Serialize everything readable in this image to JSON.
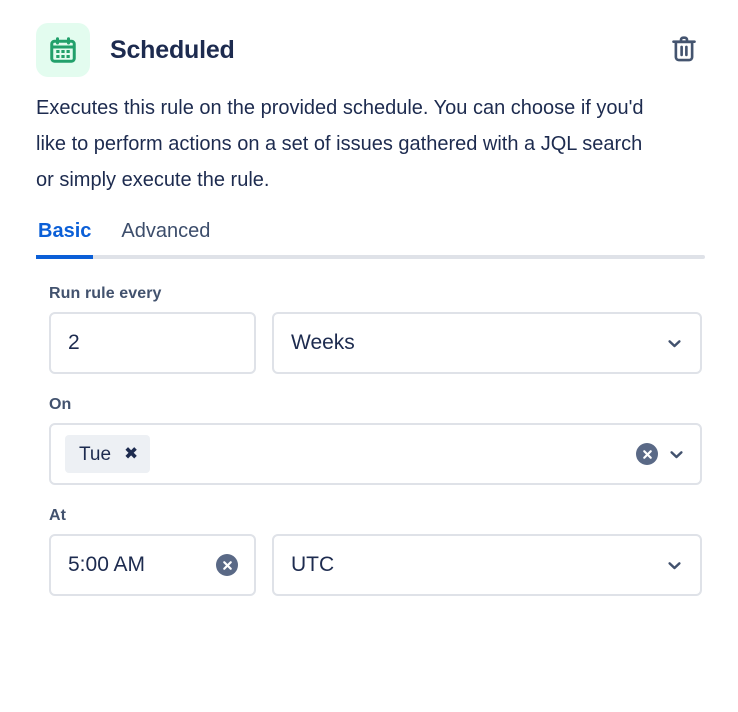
{
  "header": {
    "title": "Scheduled",
    "icon": "calendar-icon",
    "icon_bg": "#e3fcef",
    "icon_color": "#22a06b",
    "delete_icon": "trash-icon",
    "delete_icon_color": "#44546f"
  },
  "description": "Executes this rule on the provided schedule. You can choose if you'd like to perform actions on a set of issues gathered with a JQL search or simply execute the rule.",
  "tabs": [
    {
      "label": "Basic",
      "active": true
    },
    {
      "label": "Advanced",
      "active": false
    }
  ],
  "accent_color": "#0b5fd7",
  "form": {
    "run_rule_every": {
      "label": "Run rule every",
      "interval_value": "2",
      "interval_placeholder": "",
      "unit_value": "Weeks",
      "unit_chevron": "chevron-down-icon"
    },
    "on": {
      "label": "On",
      "chips": [
        {
          "label": "Tue",
          "remove_icon": "✖"
        }
      ],
      "clear_icon": "clear-circle-icon",
      "chevron": "chevron-down-icon"
    },
    "at": {
      "label": "At",
      "time_value": "5:00 AM",
      "time_clear_icon": "clear-circle-icon",
      "timezone_value": "UTC",
      "timezone_chevron": "chevron-down-icon"
    }
  }
}
